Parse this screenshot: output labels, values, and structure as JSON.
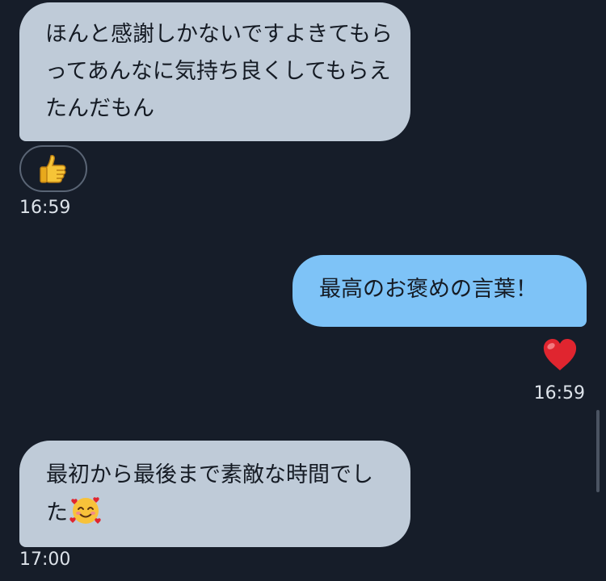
{
  "messages": [
    {
      "direction": "incoming",
      "text": "ほんと感謝しかないですよきてもらってあんなに気持ち良くしてもらえたんだもん",
      "reaction_icon": "thumbs-up-icon",
      "time": "16:59"
    },
    {
      "direction": "outgoing",
      "text": "最高のお褒めの言葉！",
      "reaction_icon": "red-heart-icon",
      "time": "16:59"
    },
    {
      "direction": "incoming",
      "text": "最初から最後まで素敵な時間でした",
      "trailing_emoji": "smiling-face-with-hearts-icon",
      "time": "17:00"
    }
  ],
  "colors": {
    "background": "#161d29",
    "incoming_bubble": "#bfcbd8",
    "outgoing_bubble": "#7ec3f7",
    "bubble_text": "#151b24",
    "timestamp": "#dde3ea"
  }
}
